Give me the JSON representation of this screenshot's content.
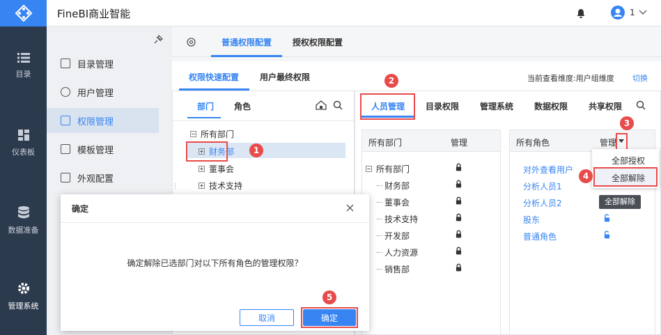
{
  "app": {
    "title": "FineBI商业智能",
    "user_count": "1"
  },
  "leftnav": [
    {
      "label": "目录",
      "icon": "list-icon"
    },
    {
      "label": "仪表板",
      "icon": "dashboard-icon"
    },
    {
      "label": "数据准备",
      "icon": "database-icon"
    },
    {
      "label": "管理系统",
      "icon": "gear-icon"
    }
  ],
  "submenu": [
    {
      "label": "目录管理",
      "icon": "catalog-icon"
    },
    {
      "label": "用户管理",
      "icon": "user-icon"
    },
    {
      "label": "权限管理",
      "icon": "lock-icon"
    },
    {
      "label": "模板管理",
      "icon": "template-icon"
    },
    {
      "label": "外观配置",
      "icon": "brush-icon"
    }
  ],
  "tabs": {
    "main": [
      "普通权限配置",
      "授权权限配置"
    ],
    "sub": [
      "权限快速配置",
      "用户最终权限"
    ]
  },
  "dimension": {
    "text": "当前查看维度:用户组维度",
    "switch": "切换"
  },
  "left_panel": {
    "tabs": [
      "部门",
      "角色"
    ],
    "tree": [
      "所有部门",
      "财务部",
      "董事会",
      "技术支持"
    ]
  },
  "right_tabs": [
    "人员管理",
    "目录权限",
    "管理系统",
    "数据权限",
    "共享权限"
  ],
  "dept_table": {
    "col1": "所有部门",
    "col2": "管理",
    "rows": [
      "所有部门",
      "财务部",
      "董事会",
      "技术支持",
      "开发部",
      "人力资源",
      "销售部"
    ]
  },
  "role_table": {
    "col1": "所有角色",
    "col2": "管理",
    "rows": [
      "对外查看用户",
      "分析人员1",
      "分析人员2",
      "股东",
      "普通角色"
    ]
  },
  "dropdown": {
    "items": [
      "全部授权",
      "全部解除"
    ],
    "tooltip": "全部解除"
  },
  "dialog": {
    "title": "确定",
    "message": "确定解除已选部门对以下所有角色的管理权限？",
    "cancel": "取消",
    "ok": "确定"
  },
  "badges": [
    "1",
    "2",
    "3",
    "4",
    "5"
  ],
  "colors": {
    "accent": "#3685f2",
    "nav_bg": "#2c3a4e",
    "highlight": "#e94a4a"
  }
}
